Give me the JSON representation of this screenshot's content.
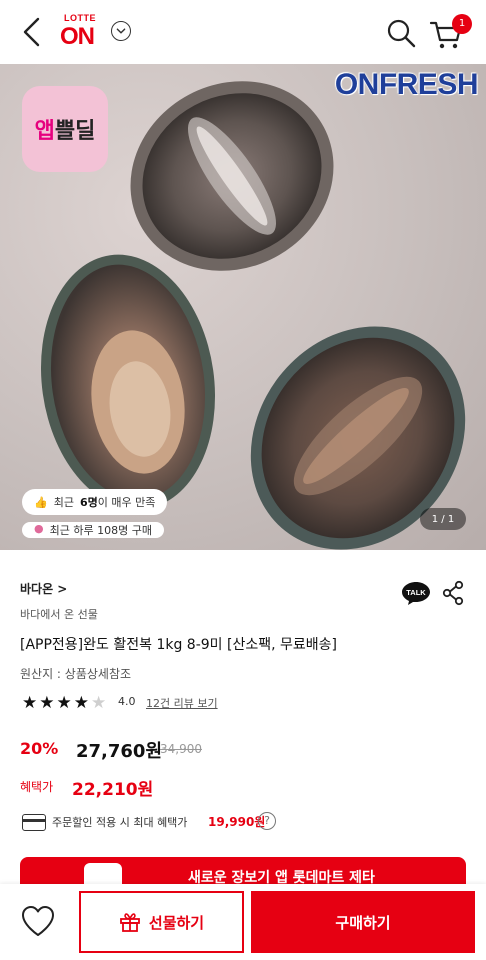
{
  "header": {
    "logo_top": "LOTTE",
    "logo_main": "ON",
    "cart_count": "1"
  },
  "hero": {
    "brand": "ONFRESH",
    "app_badge_a": "앱",
    "app_badge_b": "쁠딜",
    "chip1_pre": "최근",
    "chip1_num": "6명",
    "chip1_post": "이 매우 만족",
    "chip2": "최근 하루 108명 구매",
    "pager": "1 / 1"
  },
  "product": {
    "store": "바다온 >",
    "subtitle": "바다에서 온 선물",
    "title": "[APP전용]완도 활전복 1kg 8-9미 [산소팩, 무료배송]",
    "origin": "원산지 : 상품상세참조",
    "rating": "4.0",
    "rating_value": 4,
    "reviews": "12건 리뷰 보기",
    "discount": "20%",
    "price": "27,760원",
    "original_price": "34,900",
    "benefit_label": "혜택가",
    "benefit_price": "22,210원",
    "coupon_text": "주문할인 적용 시 최대 혜택가",
    "coupon_value": "19,990원",
    "help": "?",
    "talk": "TALK"
  },
  "promo": {
    "text": "새로운 장보기 앱 롯데마트 제타"
  },
  "bottom": {
    "gift_label": "선물하기",
    "buy_label": "구매하기"
  },
  "colors": {
    "accent": "#e60012",
    "brand_blue": "#1f3f9a",
    "app_badge": "#f3c2d6"
  },
  "icons": [
    "back-icon",
    "chevron-down-icon",
    "search-icon",
    "cart-icon",
    "talk-icon",
    "share-icon",
    "star-icon",
    "card-icon",
    "help-icon",
    "heart-icon",
    "gift-icon"
  ]
}
